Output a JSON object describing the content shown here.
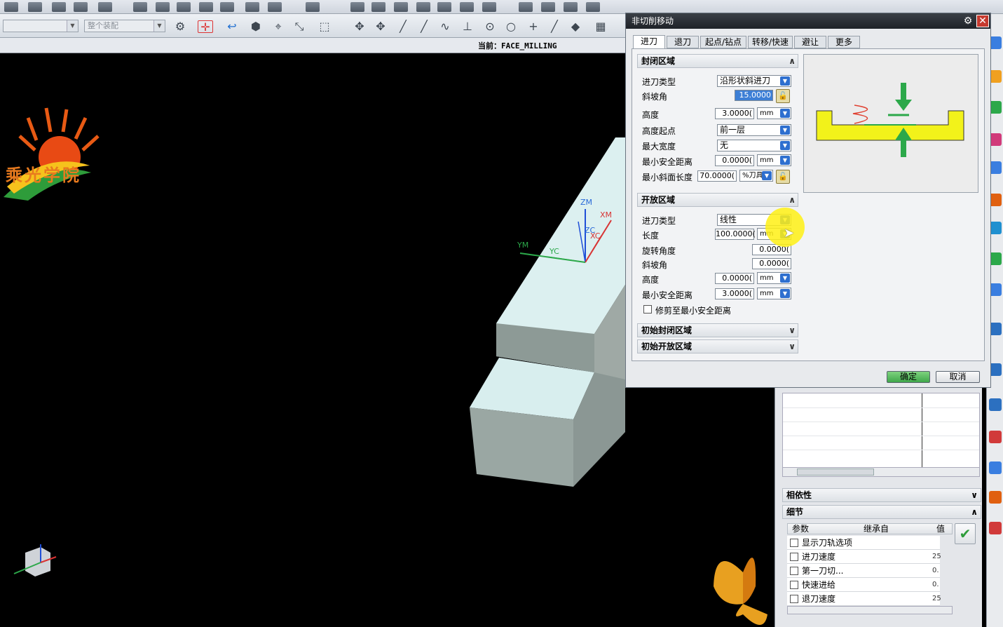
{
  "header": {
    "current_label": "当前：FACE_MILLING",
    "selection_filter": "",
    "assembly_scope": "整个装配"
  },
  "logo": {
    "text": "乘光学院"
  },
  "dialog": {
    "title": "非切削移动",
    "tabs": [
      "进刀",
      "退刀",
      "起点/钻点",
      "转移/快速",
      "避让",
      "更多"
    ],
    "closed_area": {
      "title": "封闭区域",
      "engage_type_label": "进刀类型",
      "engage_type_value": "沿形状斜进刀",
      "ramp_angle_label": "斜坡角",
      "ramp_angle_value": "15.0000",
      "height_label": "高度",
      "height_value": "3.0000(",
      "height_unit": "mm",
      "height_from_label": "高度起点",
      "height_from_value": "前一层",
      "max_width_label": "最大宽度",
      "max_width_value": "无",
      "min_clearance_label": "最小安全距离",
      "min_clearance_value": "0.0000(",
      "min_clearance_unit": "mm",
      "min_ramp_len_label": "最小斜面长度",
      "min_ramp_len_value": "70.0000(",
      "min_ramp_len_unit": "%刀具"
    },
    "open_area": {
      "title": "开放区域",
      "engage_type_label": "进刀类型",
      "engage_type_value": "线性",
      "length_label": "长度",
      "length_value": "100.0000(",
      "length_unit": "mm",
      "rotation_label": "旋转角度",
      "rotation_value": "0.0000(",
      "ramp_label": "斜坡角",
      "ramp_value": "0.0000(",
      "height_label": "高度",
      "height_value": "0.0000(",
      "height_unit": "mm",
      "min_clearance_label": "最小安全距离",
      "min_clearance_value": "3.0000(",
      "min_clearance_unit": "mm",
      "trim_label": "修剪至最小安全距离"
    },
    "initial_closed": "初始封闭区域",
    "initial_open": "初始开放区域",
    "ok": "确定",
    "cancel": "取消"
  },
  "axes": {
    "zm": "ZM",
    "xm": "XM",
    "ym": "YM",
    "yc": "YC",
    "zc": "ZC",
    "xc": "XC"
  },
  "right_panel": {
    "dependency": "相依性",
    "details": "细节",
    "columns": [
      "参数",
      "继承自",
      "值"
    ],
    "rows": [
      {
        "name": "显示刀轨选项",
        "value": ""
      },
      {
        "name": "进刀速度",
        "value": "25"
      },
      {
        "name": "第一刀切...",
        "value": "0."
      },
      {
        "name": "快速进给",
        "value": "0."
      },
      {
        "name": "退刀速度",
        "value": "25"
      }
    ]
  }
}
